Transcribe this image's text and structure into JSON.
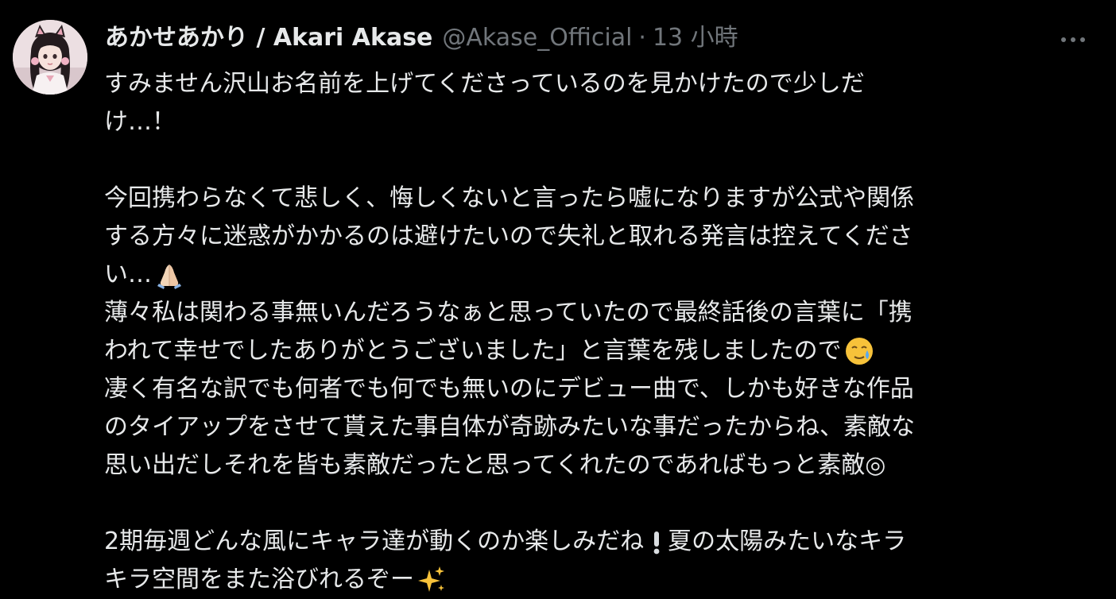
{
  "author": {
    "display_name": "あかせあかり / Akari Akase",
    "handle": "@Akase_Official",
    "separator": "·",
    "timestamp": "13 小時"
  },
  "menu": {
    "icon": "more-horizontal-icon"
  },
  "post": {
    "lines": [
      "すみません沢山お名前を上げてくださっているのを見かけたので少しだ",
      "け…！",
      "",
      "今回携わらなくて悲しく、悔しくないと言ったら嘘になりますが公式や関係",
      "する方々に迷惑がかかるのは避けたいので失礼と取れる発言は控えてくださ",
      "い…",
      "薄々私は関わる事無いんだろうなぁと思っていたので最終話後の言葉に「携",
      "われて幸せでしたありがとうございました」と言葉を残しましたので",
      "凄く有名な訳でも何者でも何でも無いのにデビュー曲で、しかも好きな作品",
      "のタイアップをさせて貰えた事自体が奇跡みたいな事だったからね、素敵な",
      "思い出だしそれを皆も素敵だったと思ってくれたのであればもっと素敵◎",
      "",
      "2期毎週どんな風にキャラ達が動くのか楽しみだね",
      "キラ空間をまた浴びれるぞー"
    ],
    "line12_tail": "夏の太陽みたいなキラ",
    "emojis": {
      "praying_hands": "praying-hands-icon",
      "face_holding_back_tears": "face-holding-back-tears-icon",
      "exclamation": "exclamation-icon",
      "sparkles": "sparkles-icon"
    }
  }
}
